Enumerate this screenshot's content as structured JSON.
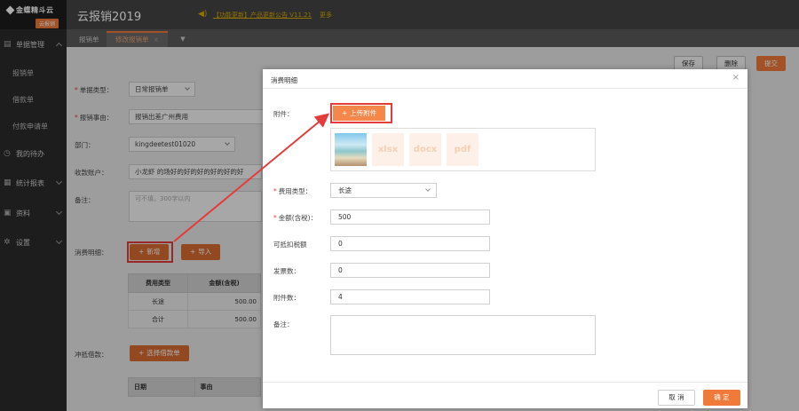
{
  "sidebar": {
    "logo_main": "金蝶精斗云",
    "logo_sub": "云报销",
    "groups": [
      {
        "label": "单据管理",
        "icon": "document-icon"
      },
      {
        "label": "我的待办",
        "icon": "clock-icon"
      },
      {
        "label": "统计报表",
        "icon": "chart-icon"
      },
      {
        "label": "资料",
        "icon": "folder-icon"
      },
      {
        "label": "设置",
        "icon": "gear-icon"
      }
    ],
    "items": [
      "报销单",
      "借款单",
      "付款申请单"
    ]
  },
  "topbar": {
    "title": "云报销2019",
    "notice": "【功能更新】产品更新公告 V11.21",
    "more": "更多"
  },
  "tabs": {
    "items": [
      {
        "label": "报销单"
      },
      {
        "label": "修改报销单"
      }
    ],
    "close": "×",
    "dropdown": "▼"
  },
  "toolbar": {
    "save": "保存",
    "delete": "删除",
    "submit": "提交"
  },
  "form": {
    "doc_type_label": "单据类型：",
    "doc_type_value": "日常报销单",
    "reason_label": "报销事由：",
    "reason_value": "报销出差广州费用",
    "dept_label": "部门：",
    "dept_value": "kingdeetest01020",
    "payee_label": "收款账户：",
    "payee_value": "小龙虾 的场好的好的好的好的好的好",
    "remark_label": "备注：",
    "remark_placeholder": "可不填，300字以内",
    "detail_label": "消费明细：",
    "add_btn": "新增",
    "import_btn": "导入",
    "table_headers": [
      "费用类型",
      "金额(含税)"
    ],
    "table_rows": [
      {
        "type": "长途",
        "amount": "500.00"
      },
      {
        "type": "合计",
        "amount": "500.00"
      }
    ],
    "offset_label": "冲抵借款：",
    "select_loan_btn": "选择借款单",
    "table2_headers": [
      "日期",
      "事由"
    ]
  },
  "modal": {
    "title": "消费明细",
    "close": "×",
    "attach_label": "附件：",
    "upload_btn": "上传附件",
    "attachments": [
      "image",
      "xlsx",
      "docx",
      "pdf"
    ],
    "fee_type_label": "费用类型：",
    "fee_type_value": "长途",
    "amount_label": "金额(含税)：",
    "amount_value": "500",
    "deductible_label": "可抵扣税额",
    "deductible_value": "0",
    "invoice_count_label": "发票数：",
    "invoice_count_value": "0",
    "attach_count_label": "附件数：",
    "attach_count_value": "4",
    "remark_label": "备注：",
    "cancel": "取 消",
    "ok": "确 定"
  }
}
